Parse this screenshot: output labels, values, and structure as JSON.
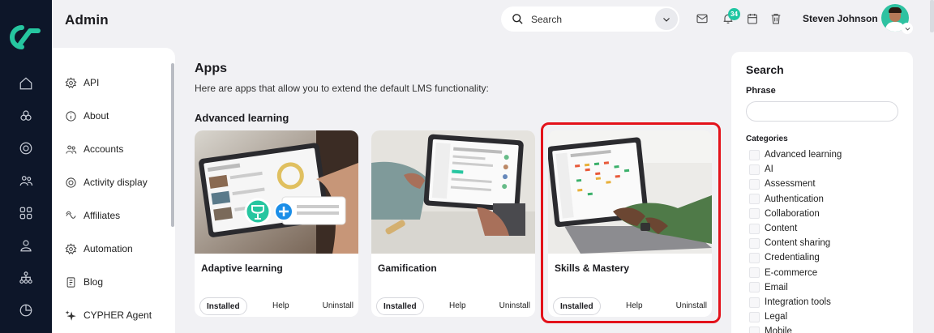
{
  "header": {
    "title": "Admin",
    "search_placeholder": "Search",
    "notification_count": "34",
    "user_name": "Steven Johnson"
  },
  "rail": {
    "icons": [
      "logo-icon",
      "home-icon",
      "courses-icon",
      "target-icon",
      "users-icon",
      "grid-icon",
      "person-icon",
      "hierarchy-icon",
      "report-icon"
    ]
  },
  "nav": {
    "items": [
      {
        "label": "API",
        "icon": "gear-icon"
      },
      {
        "label": "About",
        "icon": "info-icon"
      },
      {
        "label": "Accounts",
        "icon": "accounts-icon"
      },
      {
        "label": "Activity display",
        "icon": "target-icon"
      },
      {
        "label": "Affiliates",
        "icon": "affiliates-icon"
      },
      {
        "label": "Automation",
        "icon": "gear-icon"
      },
      {
        "label": "Blog",
        "icon": "blog-icon"
      },
      {
        "label": "CYPHER Agent",
        "icon": "sparkle-icon"
      }
    ]
  },
  "main": {
    "heading": "Apps",
    "intro": "Here are apps that allow you to extend the default LMS functionality:",
    "section": "Advanced learning",
    "cards": [
      {
        "name": "Adaptive learning",
        "installed": "Installed",
        "help": "Help",
        "uninstall": "Uninstall"
      },
      {
        "name": "Gamification",
        "installed": "Installed",
        "help": "Help",
        "uninstall": "Uninstall"
      },
      {
        "name": "Skills & Mastery",
        "installed": "Installed",
        "help": "Help",
        "uninstall": "Uninstall"
      }
    ],
    "highlight_color": "#e3121b"
  },
  "filter": {
    "title": "Search",
    "phrase_label": "Phrase",
    "phrase_value": "",
    "categories_label": "Categories",
    "categories": [
      "Advanced learning",
      "AI",
      "Assessment",
      "Authentication",
      "Collaboration",
      "Content",
      "Content sharing",
      "Credentialing",
      "E-commerce",
      "Email",
      "Integration tools",
      "Legal",
      "Mobile"
    ]
  },
  "colors": {
    "rail": "#0d1629",
    "accent": "#1fc6a2"
  }
}
